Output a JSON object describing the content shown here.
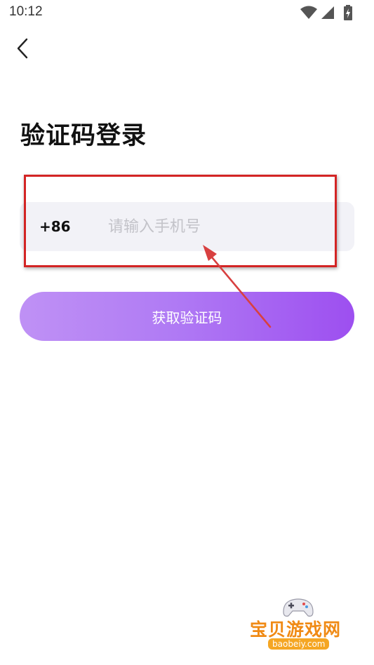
{
  "status_bar": {
    "time": "10:12",
    "icons": [
      "wifi-icon",
      "signal-icon",
      "battery-charging-icon"
    ]
  },
  "nav": {
    "back_icon": "chevron-left-icon"
  },
  "title": "验证码登录",
  "phone": {
    "country_code": "+86",
    "placeholder": "请输入手机号",
    "value": ""
  },
  "get_code_button": {
    "label": "获取验证码"
  },
  "colors": {
    "button_gradient_start": "#bf91f5",
    "button_gradient_end": "#9d4ff0",
    "input_background": "#f2f2f7",
    "annotation_red": "#d32424"
  },
  "watermark": {
    "text": "宝贝游戏网",
    "url": "baobeiy.com"
  }
}
